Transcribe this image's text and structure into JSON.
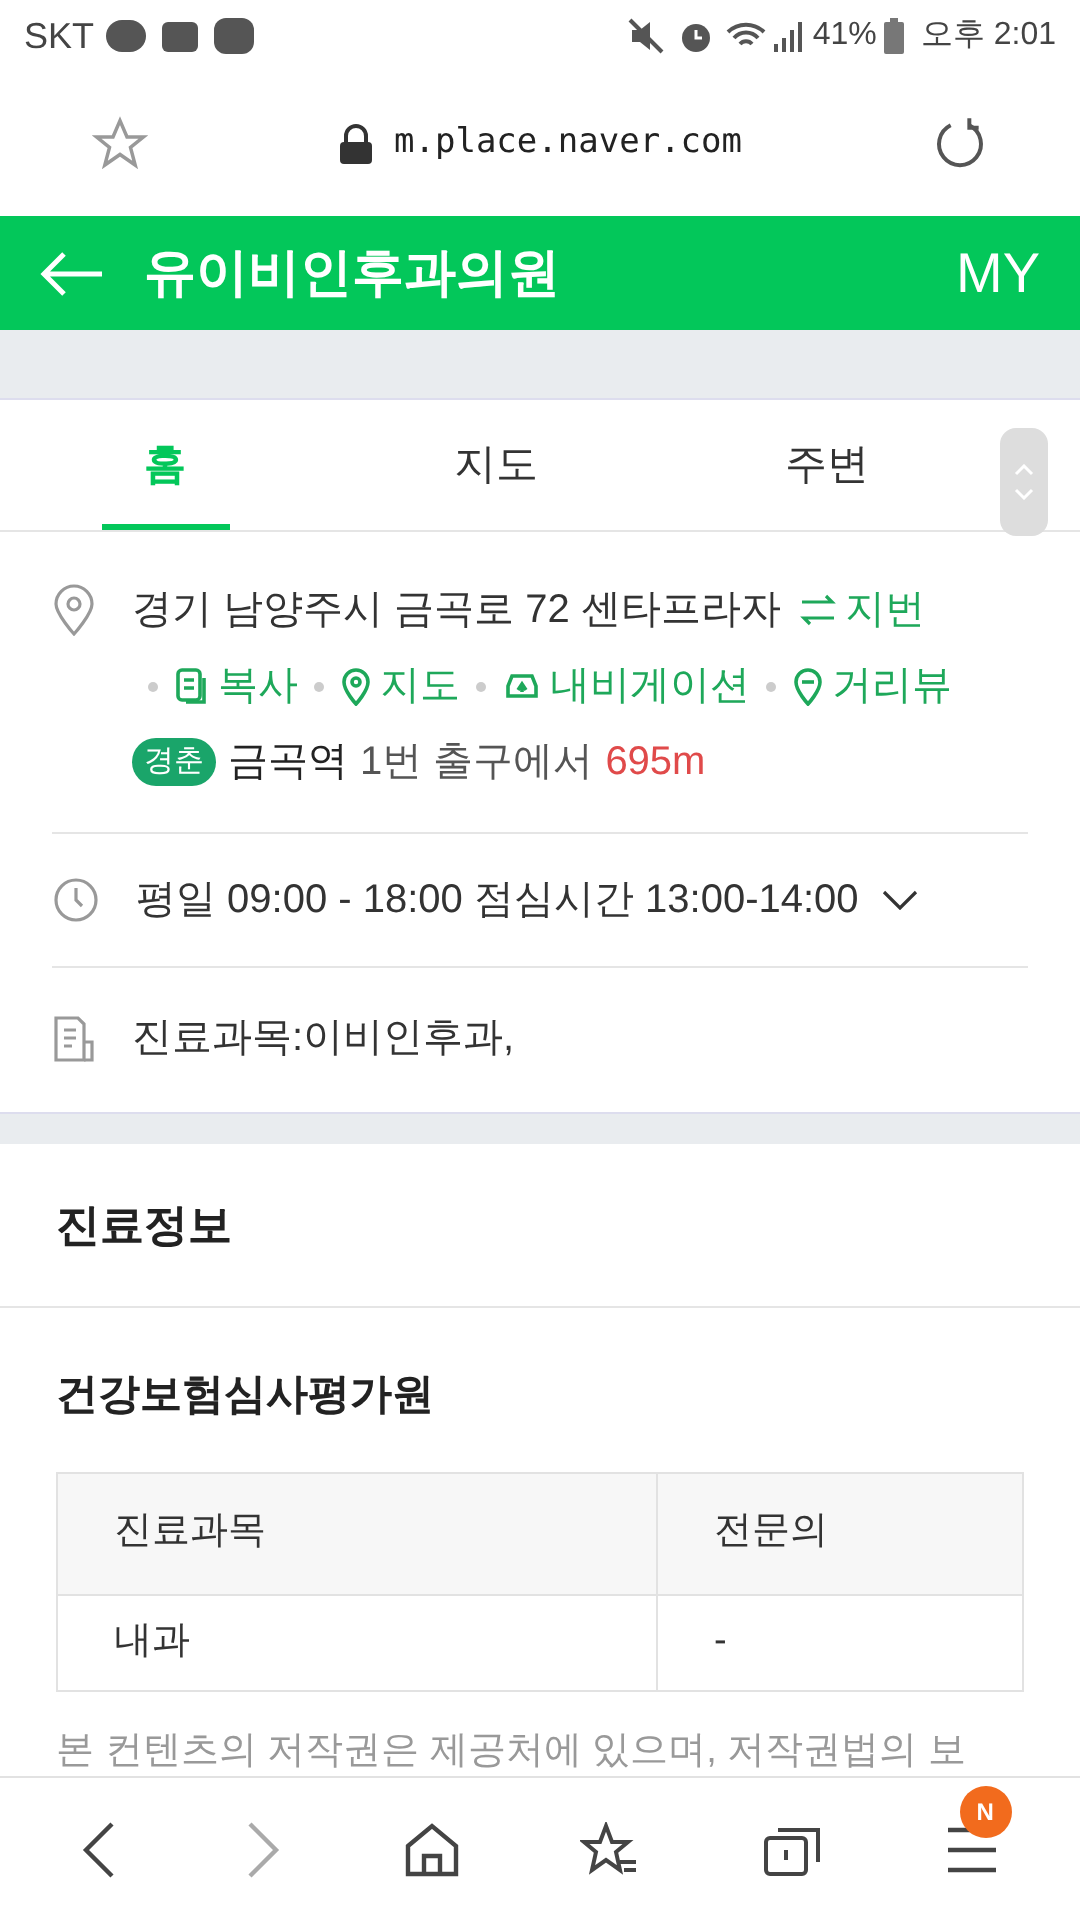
{
  "status_bar": {
    "carrier": "SKT",
    "battery": "41%",
    "time": "오후 2:01"
  },
  "browser": {
    "url": "m.place.naver.com"
  },
  "header": {
    "title": "유이비인후과의원",
    "my": "MY"
  },
  "tabs": [
    {
      "label": "홈",
      "selected": true
    },
    {
      "label": "지도",
      "selected": false
    },
    {
      "label": "주변",
      "selected": false
    }
  ],
  "address": {
    "text": "경기 남양주시 금곡로 72 센타프라자",
    "toggle": "지번",
    "actions": [
      {
        "kind": "copy",
        "label": "복사"
      },
      {
        "kind": "map",
        "label": "지도"
      },
      {
        "kind": "navigation",
        "label": "내비게이션"
      },
      {
        "kind": "streetview",
        "label": "거리뷰"
      }
    ],
    "subway": {
      "line": "경춘",
      "station": "금곡역",
      "exit": "1번 출구에서",
      "distance": "695m"
    }
  },
  "hours": {
    "text": "평일 09:00 - 18:00 점심시간 13:00-14:00",
    "expanded": false
  },
  "departments": "진료과목:이비인후과,",
  "section_title": "진료정보",
  "subsection_title": "건강보험심사평가원",
  "table": {
    "columns": [
      "진료과목",
      "전문의"
    ],
    "rows": [
      [
        "내과",
        "-"
      ]
    ]
  },
  "notice": "본 컨텐츠의 저작권은 제공처에 있으며, 저작권법의 보",
  "bottom_nav": {
    "badge": "N"
  }
}
